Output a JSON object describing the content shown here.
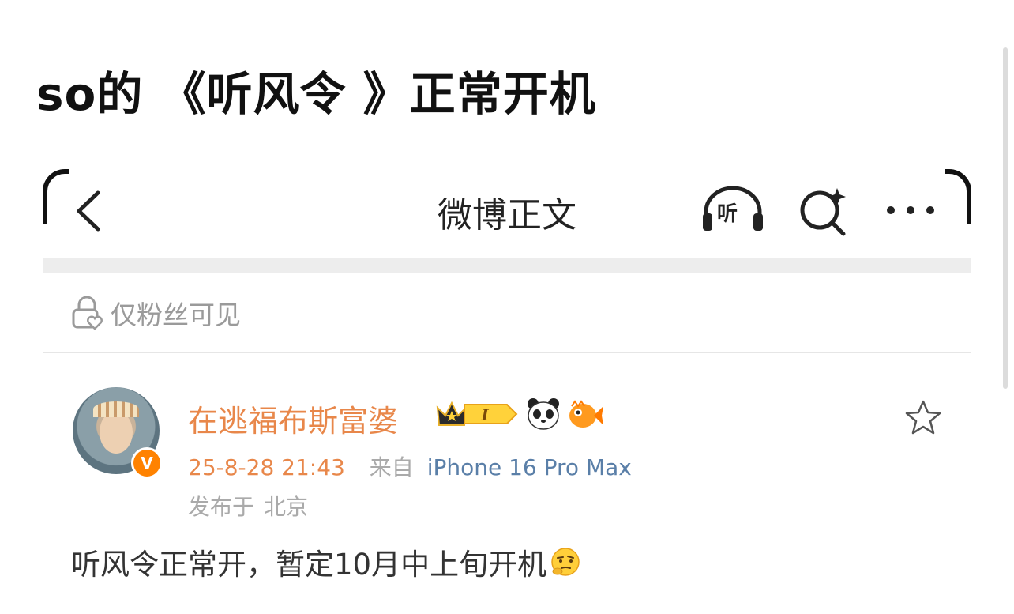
{
  "headline": "so的 《听风令 》正常开机",
  "nav": {
    "title": "微博正文",
    "listen_label": "听"
  },
  "visibility": "仅粉丝可见",
  "post": {
    "username": "在逃福布斯富婆",
    "vip_label": "I",
    "verify_mark": "V",
    "time": "25-8-28 21:43",
    "from_label": "来自",
    "device": "iPhone 16 Pro Max",
    "location_label": "发布于",
    "location": "北京",
    "text": "听风令正常开，暂定10月中上旬开机"
  },
  "colors": {
    "username": "#e8874a",
    "device": "#5a7fa8",
    "verify": "#ff8200"
  },
  "icons": [
    "back-icon",
    "listen-headphones-icon",
    "ai-search-icon",
    "more-icon",
    "lock-heart-icon",
    "star-icon",
    "panda-emoji-icon",
    "fish-emoji-icon",
    "thinking-emoji-icon"
  ]
}
